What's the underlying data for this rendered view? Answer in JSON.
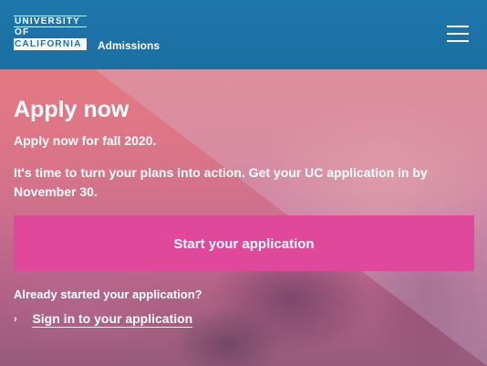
{
  "header": {
    "logo_lines": [
      "UNIVERSITY",
      "OF",
      "CALIFORNIA"
    ],
    "section": "Admissions",
    "menu_icon": "hamburger-menu-icon"
  },
  "hero": {
    "title": "Apply now",
    "subtitle": "Apply now for fall 2020.",
    "description": "It's time to turn your plans into action. Get your UC application in by November 30.",
    "cta_label": "Start your application",
    "already_text": "Already started your application?",
    "signin_link": "Sign in to your application",
    "link_icon": "chevron-right-icon"
  },
  "colors": {
    "header_bg": "#1a6fa3",
    "cta_bg": "#e0489b",
    "text": "#ffffff"
  }
}
